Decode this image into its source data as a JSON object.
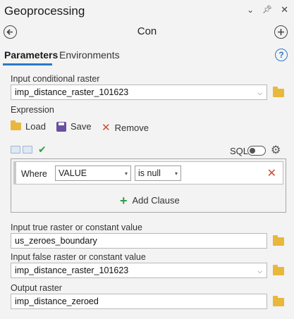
{
  "window": {
    "title": "Geoprocessing",
    "controls": {
      "menu_icon": "chevron-down",
      "pin_icon": "pin",
      "close_icon": "close"
    }
  },
  "tool": {
    "name": "Con",
    "back_icon": "back-arrow",
    "add_icon": "plus-circle"
  },
  "tabs": [
    {
      "label": "Parameters",
      "active": true
    },
    {
      "label": "Environments",
      "active": false
    }
  ],
  "help_glyph": "?",
  "params": {
    "input_conditional_raster": {
      "label": "Input conditional raster",
      "value": "imp_distance_raster_101623"
    },
    "expression": {
      "label": "Expression",
      "load_label": "Load",
      "save_label": "Save",
      "remove_label": "Remove",
      "sql_label": "SQL",
      "clause": {
        "where_label": "Where",
        "field": "VALUE",
        "operator": "is null"
      },
      "add_clause_label": "Add Clause"
    },
    "input_true": {
      "label": "Input true raster or constant value",
      "value": "us_zeroes_boundary"
    },
    "input_false": {
      "label": "Input false raster or constant value",
      "value": "imp_distance_raster_101623"
    },
    "output": {
      "label": "Output raster",
      "value": "imp_distance_zeroed"
    }
  },
  "colors": {
    "accent": "#2d79c7",
    "remove_red": "#d04a2e",
    "valid_green": "#2f9e45",
    "folder_yellow": "#e9b73b"
  }
}
